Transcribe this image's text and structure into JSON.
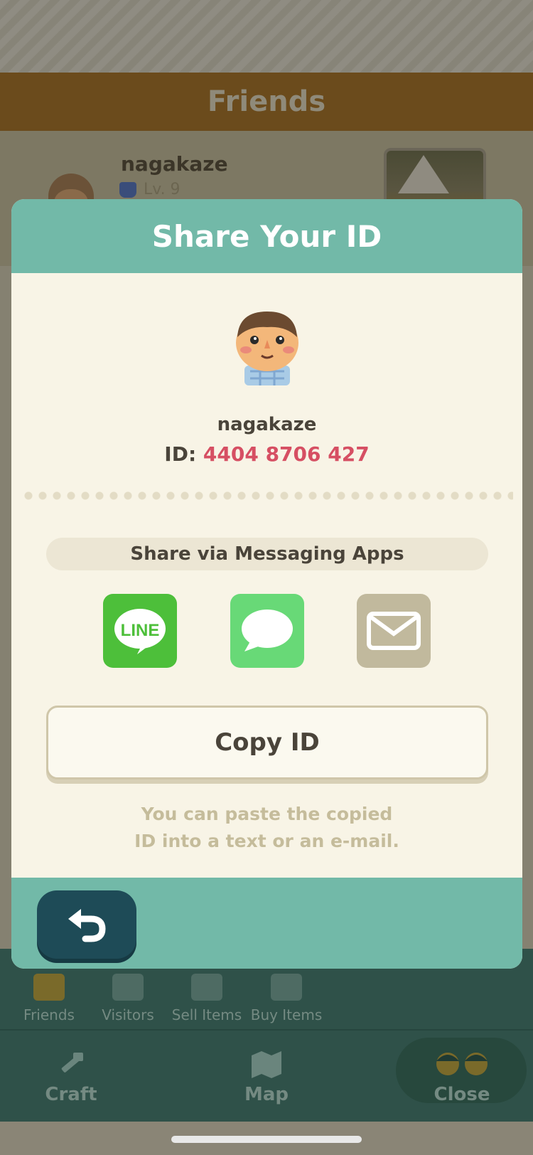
{
  "background": {
    "header_title": "Friends",
    "friend": {
      "name": "nagakaze",
      "level": "Lv. 9"
    },
    "subnav": [
      {
        "label": "Friends",
        "icon": "friends-icon"
      },
      {
        "label": "Visitors",
        "icon": "footprints-icon"
      },
      {
        "label": "Sell Items",
        "icon": "sell-box-icon"
      },
      {
        "label": "Buy Items",
        "icon": "buy-items-icon"
      }
    ],
    "bottombar": [
      {
        "label": "Craft",
        "icon": "hammer-icon"
      },
      {
        "label": "Map",
        "icon": "map-icon"
      },
      {
        "label": "Close",
        "icon": "villagers-icon"
      }
    ]
  },
  "modal": {
    "title": "Share Your ID",
    "player_name": "nagakaze",
    "id_label": "ID: ",
    "id_value": "4404 8706 427",
    "share_label": "Share via Messaging Apps",
    "share_buttons": [
      {
        "name": "line",
        "text": "LINE",
        "color": "#4dbf3a"
      },
      {
        "name": "messages",
        "color": "#68d977"
      },
      {
        "name": "mail",
        "color": "#c1b99d"
      }
    ],
    "copy_button": "Copy ID",
    "hint_line1": "You can paste the copied",
    "hint_line2": "ID into a text or an e-mail."
  },
  "colors": {
    "accent_teal": "#72b9a8",
    "id_red": "#d64f63",
    "back_button": "#1e4b57"
  }
}
